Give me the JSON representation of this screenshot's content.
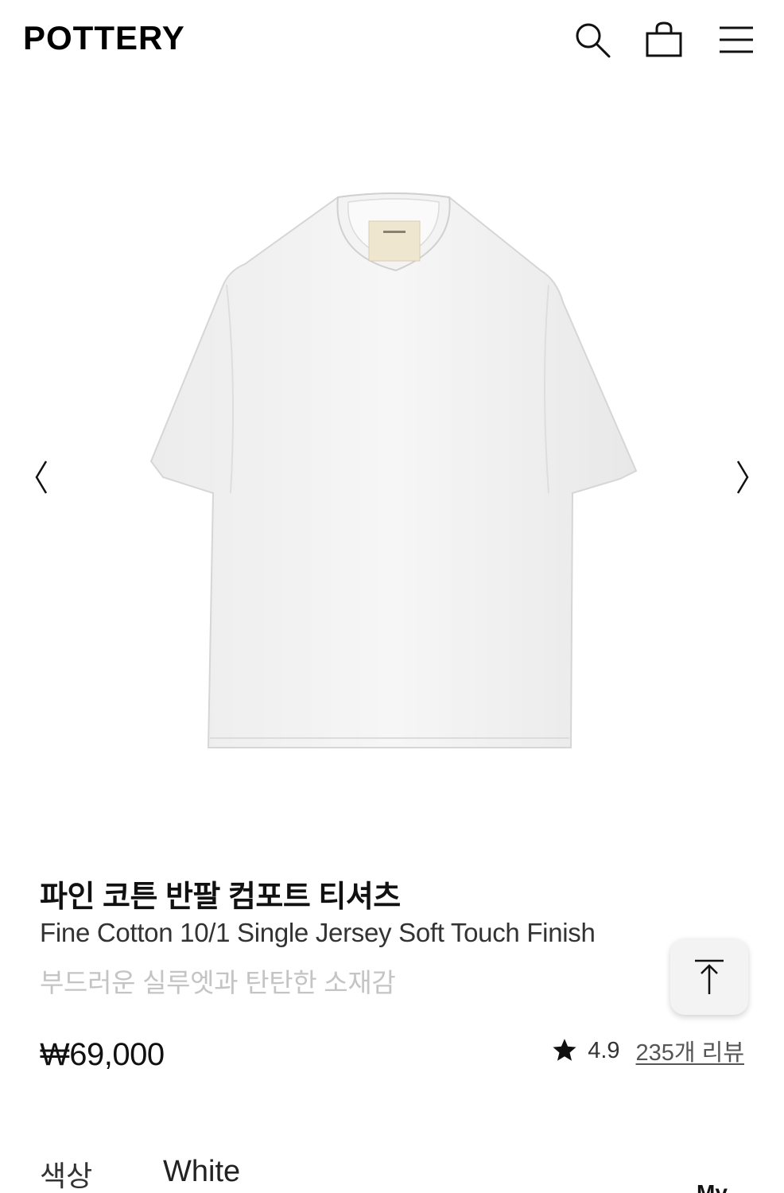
{
  "header": {
    "logo": "POTTERY",
    "icons": [
      "search-icon",
      "shopping-bag-icon",
      "menu-icon"
    ]
  },
  "gallery": {
    "prev_icon": "chevron-left-icon",
    "next_icon": "chevron-right-icon",
    "image": "white t-shirt"
  },
  "product": {
    "title_ko": "파인 코튼 반팔 컴포트 티셔츠",
    "title_en": "Fine Cotton 10/1 Single Jersey Soft Touch Finish",
    "subtitle": "부드러운 실루엣과 탄탄한 소재감",
    "price": "₩69,000",
    "rating": "4.9",
    "reviews": "235개 리뷰"
  },
  "options": {
    "color_label": "색상",
    "color_value": "White",
    "extra": "My"
  },
  "scroll_top_icon": "arrow-up-to-top-icon",
  "colors": {
    "text": "#111111",
    "muted": "#c4c4c4",
    "button_bg": "#f3f3f3"
  }
}
